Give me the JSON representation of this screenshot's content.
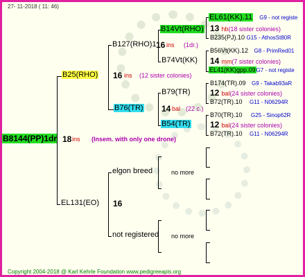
{
  "header": {
    "date": "27- 11-2018 ( 11: 46)"
  },
  "root": {
    "name": "B8144(PP)1dr",
    "count": "18",
    "code": "ins",
    "note": "(Insem. with only one drone)"
  },
  "gen1": {
    "father": {
      "name": "B25(RHO)",
      "count": "16",
      "code": "ins",
      "note": "(12 sister colonies)"
    },
    "mother": {
      "name": "EL131(EO)",
      "count": "16"
    }
  },
  "gen2": {
    "b127": {
      "name": "B127(RHO)1",
      "count": "16",
      "code": "ins",
      "note": "(1dr.)"
    },
    "b76": {
      "name": "B76(TR)",
      "count": "14",
      "code": "bal",
      "note": "(22 c.)"
    },
    "elgon": {
      "name": "elgon breed",
      "more": "no more"
    },
    "notreg": {
      "name": "not registered",
      "more": "no more"
    }
  },
  "gen3": {
    "b14vt": "B14Vt(RHO)",
    "b74vt": "B74Vt(KK)",
    "b79": "B79(TR)",
    "b54": "B54(TR)"
  },
  "gen4": {
    "r1": {
      "name": "EL61(KK).11",
      "info": "G9 - not registe"
    },
    "r2": {
      "count": "13",
      "code": "hb",
      "note": "(18 sister colonies)"
    },
    "r3": {
      "name": "B235(PJ).10",
      "info": "G15 - AthosSt80R"
    },
    "r4": {
      "name": "B56Vt(KK).12",
      "info": "G8 - PrimRed01"
    },
    "r5": {
      "count": "14",
      "code": "mm",
      "note": "(7 sister colonies)"
    },
    "r6": {
      "name": "EL41(KK)gpp.09",
      "info": "G7 - not registe"
    },
    "r7": {
      "name": "B174(TR).09",
      "info": "G9 - Takab93aR"
    },
    "r8": {
      "count": "12",
      "code": "bal",
      "note": "(24 sister colonies)"
    },
    "r9": {
      "name": "B72(TR).10",
      "info": "G11 - N06294R"
    },
    "r10": {
      "name": "B70(TR).10",
      "info": "G25 - Sinop62R"
    },
    "r11": {
      "count": "12",
      "code": "bal",
      "note": "(24 sister colonies)"
    },
    "r12": {
      "name": "B72(TR).10",
      "info": "G11 - N06294R"
    }
  },
  "colors": {
    "border": "#e020a0",
    "highlight_green": "#22dd22",
    "highlight_yellow": "#ffff44",
    "highlight_cyan": "#33ddee",
    "code_red": "#cc0000",
    "note_purple": "#aa00aa",
    "info_blue": "#0000cc"
  },
  "footer": {
    "copyright": "Copyright 2004-2018 @ Karl Kehrle Foundation    www.pedigreeapis.org"
  }
}
